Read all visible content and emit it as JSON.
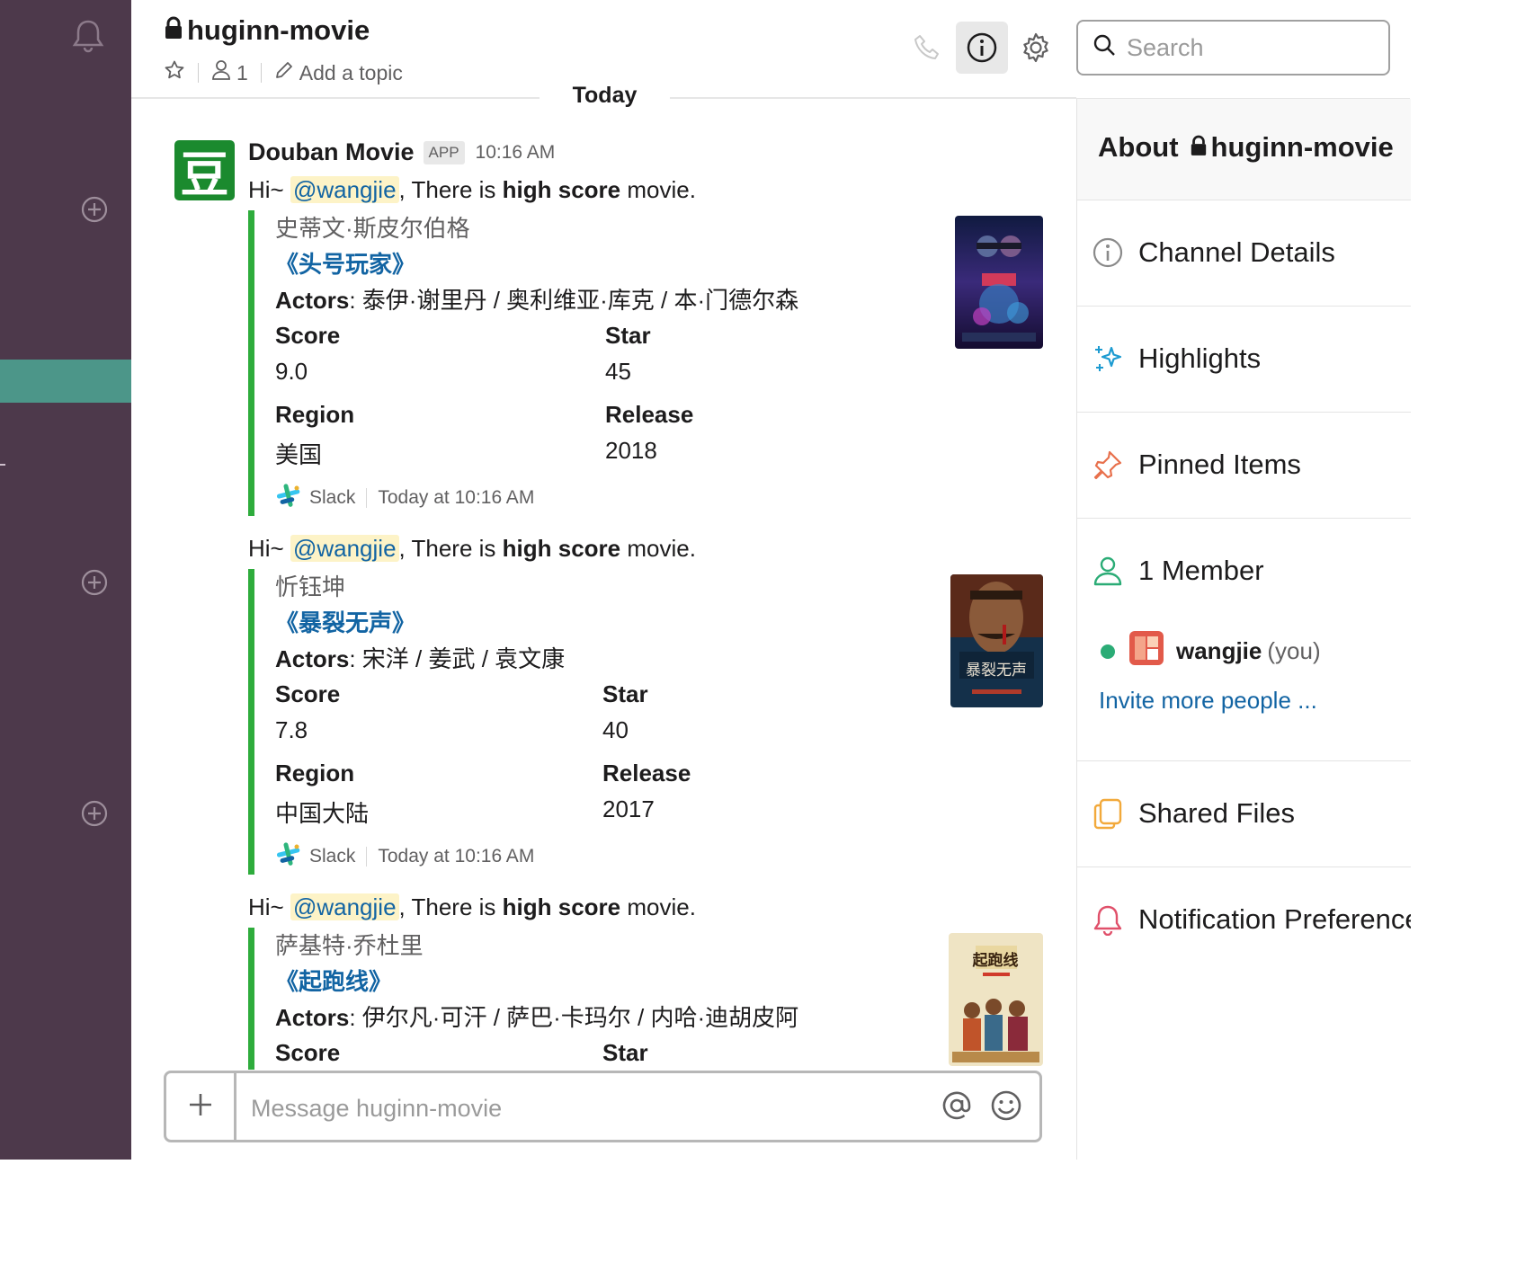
{
  "channel": {
    "name": "huginn-movie",
    "member_count": "1",
    "add_topic": "Add a topic"
  },
  "search": {
    "placeholder": "Search"
  },
  "divider": {
    "today": "Today"
  },
  "sender": {
    "name": "Douban Movie",
    "badge": "APP",
    "time": "10:16 AM",
    "avatar_glyph": "豆"
  },
  "messages": [
    {
      "greeting": "Hi~ ",
      "mention": "@wangjie",
      "text_a": ", There is ",
      "text_bold": "high score",
      "text_b": " movie.",
      "author": "史蒂文·斯皮尔伯格",
      "title": "《头号玩家》",
      "actors_label": "Actors",
      "actors": ": 泰伊·谢里丹 /  奥利维亚·库克 / 本·门德尔森",
      "score_label": "Score",
      "score": "9.0",
      "star_label": "Star",
      "star": "45",
      "region_label": "Region",
      "region": "美国",
      "release_label": "Release",
      "release": "2018",
      "footer_source": "Slack",
      "footer_time": "Today at 10:16 AM"
    },
    {
      "greeting": "Hi~ ",
      "mention": "@wangjie",
      "text_a": ", There is ",
      "text_bold": "high score",
      "text_b": " movie.",
      "author": "忻钰坤",
      "title": "《暴裂无声》",
      "actors_label": "Actors",
      "actors": ": 宋洋 / 姜武 / 袁文康",
      "score_label": "Score",
      "score": "7.8",
      "star_label": "Star",
      "star": "40",
      "region_label": "Region",
      "region": "中国大陆",
      "release_label": "Release",
      "release": "2017",
      "footer_source": "Slack",
      "footer_time": "Today at 10:16 AM",
      "poster_text": "暴裂无声"
    },
    {
      "greeting": "Hi~ ",
      "mention": "@wangjie",
      "text_a": ", There is ",
      "text_bold": "high score",
      "text_b": " movie.",
      "author": "萨基特·乔杜里",
      "title": "《起跑线》",
      "actors_label": "Actors",
      "actors": ": 伊尔凡·可汗 / 萨巴·卡玛尔 / 内哈·迪胡皮阿",
      "score_label": "Score",
      "star_label": "Star",
      "poster_text": "起跑线"
    }
  ],
  "composer": {
    "placeholder": "Message huginn-movie"
  },
  "sidebar": {
    "about_label": "About",
    "channel_details": "Channel Details",
    "highlights": "Highlights",
    "pinned_items": "Pinned Items",
    "members": "1 Member",
    "member_name": "wangjie",
    "member_you": "(you)",
    "invite": "Invite more people ...",
    "shared_files": "Shared Files",
    "notification_prefs": "Notification Preferences"
  },
  "colors": {
    "rail": "#4d394b",
    "rail_active": "#4c9689",
    "attachment_bar": "#2eac3c",
    "link": "#1264a3",
    "mention_bg": "#fdf3c7",
    "presence": "#2bac76"
  }
}
